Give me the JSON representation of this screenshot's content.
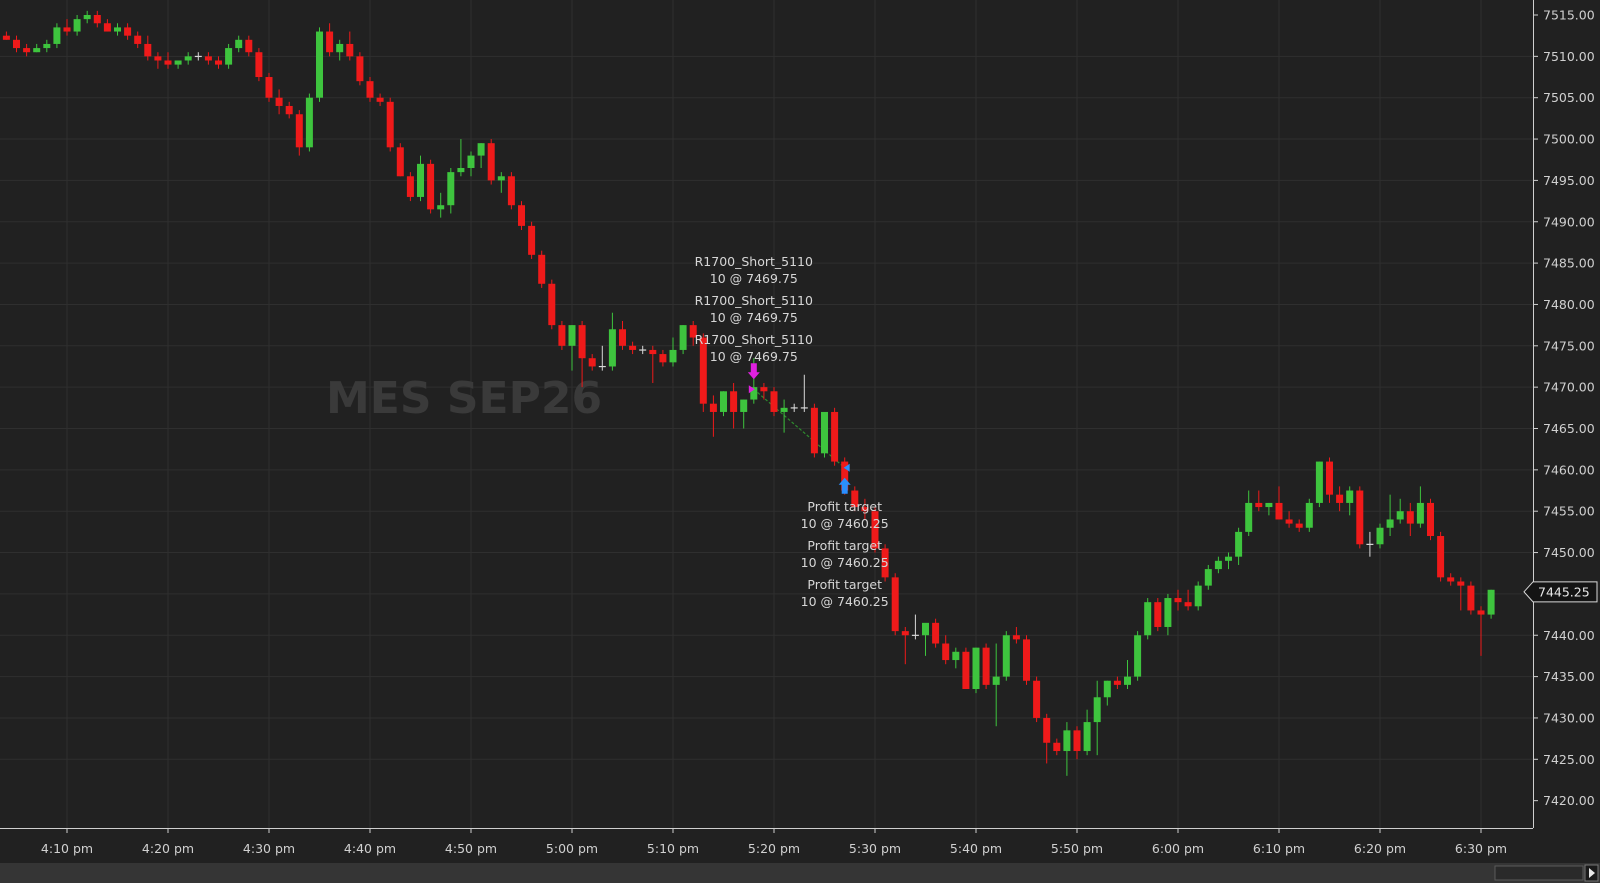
{
  "chart_data": {
    "type": "candlestick",
    "instrument": "MES SEP26",
    "last_price": "7445.25",
    "x_axis": {
      "tick_labels": [
        "4:10 pm",
        "4:20 pm",
        "4:30 pm",
        "4:40 pm",
        "4:50 pm",
        "5:00 pm",
        "5:10 pm",
        "5:20 pm",
        "5:30 pm",
        "5:40 pm",
        "5:50 pm",
        "6:00 pm",
        "6:10 pm",
        "6:20 pm",
        "6:30 pm"
      ],
      "first_tick_minutes": 250,
      "tick_step_minutes": 10
    },
    "y_axis": {
      "min": 7420,
      "max": 7515,
      "tick_step": 5,
      "tick_labels": [
        "7515.00",
        "7510.00",
        "7505.00",
        "7500.00",
        "7495.00",
        "7490.00",
        "7485.00",
        "7480.00",
        "7475.00",
        "7470.00",
        "7465.00",
        "7460.00",
        "7455.00",
        "7450.00",
        "7445.00",
        "7440.00",
        "7435.00",
        "7430.00",
        "7425.00",
        "7420.00"
      ]
    },
    "grid": true,
    "bar_interval_minutes": 1,
    "colors": {
      "up": "#3ec43e",
      "down": "#ef1a1a",
      "flat": "#d8d8d8",
      "entry_marker": "#e020e0",
      "exit_marker": "#2a8fff",
      "background": "#212121",
      "grid": "#2f2f2f"
    },
    "candles": [
      [
        243,
        7513,
        7513.5,
        7512.5,
        7512.5
      ],
      [
        244,
        7512.5,
        7513,
        7512,
        7512
      ],
      [
        245,
        7512,
        7512.5,
        7510.5,
        7511
      ],
      [
        246,
        7511,
        7511.5,
        7510,
        7510.5
      ],
      [
        247,
        7510.5,
        7511.5,
        7510.5,
        7511
      ],
      [
        248,
        7511,
        7512,
        7510.5,
        7511.5
      ],
      [
        249,
        7511.5,
        7514,
        7511,
        7513.5
      ],
      [
        250,
        7513.5,
        7514.5,
        7512.5,
        7513
      ],
      [
        251,
        7513,
        7515,
        7512.5,
        7514.5
      ],
      [
        252,
        7514.5,
        7515.5,
        7514,
        7515
      ],
      [
        253,
        7515,
        7515.5,
        7513.5,
        7514
      ],
      [
        254,
        7514,
        7514.5,
        7513,
        7513
      ],
      [
        255,
        7513,
        7514,
        7512.5,
        7513.5
      ],
      [
        256,
        7513.5,
        7514,
        7512,
        7512.5
      ],
      [
        257,
        7512.5,
        7513,
        7511,
        7511.5
      ],
      [
        258,
        7511.5,
        7512.5,
        7509.5,
        7510
      ],
      [
        259,
        7510,
        7510.5,
        7508.5,
        7509.5
      ],
      [
        260,
        7509.5,
        7510.5,
        7508.5,
        7509
      ],
      [
        261,
        7509,
        7509.5,
        7508.5,
        7509.5
      ],
      [
        262,
        7509.5,
        7510.5,
        7509,
        7510
      ],
      [
        263,
        7510,
        7510.5,
        7509.5,
        7510
      ],
      [
        264,
        7510,
        7510.5,
        7509,
        7509.5
      ],
      [
        265,
        7509.5,
        7510,
        7508.5,
        7509
      ],
      [
        266,
        7509,
        7511.5,
        7508.5,
        7511
      ],
      [
        267,
        7511,
        7512.5,
        7510.5,
        7512
      ],
      [
        268,
        7512,
        7512.5,
        7510,
        7510.5
      ],
      [
        269,
        7510.5,
        7511,
        7507,
        7507.5
      ],
      [
        270,
        7507.5,
        7508,
        7504.5,
        7505
      ],
      [
        271,
        7505,
        7506,
        7503,
        7504
      ],
      [
        272,
        7504,
        7504.5,
        7502.5,
        7503
      ],
      [
        273,
        7503,
        7503.5,
        7498,
        7499
      ],
      [
        274,
        7499,
        7505.5,
        7498.5,
        7505
      ],
      [
        275,
        7505,
        7513.5,
        7504.5,
        7513
      ],
      [
        276,
        7513,
        7514,
        7510,
        7510.5
      ],
      [
        277,
        7510.5,
        7512,
        7509.5,
        7511.5
      ],
      [
        278,
        7511.5,
        7513,
        7509.5,
        7510
      ],
      [
        279,
        7510,
        7510.5,
        7506.5,
        7507
      ],
      [
        280,
        7507,
        7507.5,
        7504.5,
        7505
      ],
      [
        281,
        7505,
        7505.5,
        7504,
        7504.5
      ],
      [
        282,
        7504.5,
        7505,
        7498.5,
        7499
      ],
      [
        283,
        7499,
        7499.5,
        7495.5,
        7495.5
      ],
      [
        284,
        7495.5,
        7496,
        7492.5,
        7493
      ],
      [
        285,
        7493,
        7498,
        7492.5,
        7497
      ],
      [
        286,
        7497,
        7497.5,
        7491,
        7491.5
      ],
      [
        287,
        7491.5,
        7493.5,
        7490.5,
        7492
      ],
      [
        288,
        7492,
        7496.5,
        7491,
        7496
      ],
      [
        289,
        7496,
        7500,
        7495.5,
        7496.5
      ],
      [
        290,
        7496.5,
        7498.5,
        7495.5,
        7498
      ],
      [
        291,
        7498,
        7499.5,
        7496.5,
        7499.5
      ],
      [
        292,
        7499.5,
        7500,
        7494.5,
        7495
      ],
      [
        293,
        7495,
        7496,
        7493.5,
        7495.5
      ],
      [
        294,
        7495.5,
        7496,
        7491.5,
        7492
      ],
      [
        295,
        7492,
        7492.5,
        7489,
        7489.5
      ],
      [
        296,
        7489.5,
        7490,
        7485.5,
        7486
      ],
      [
        297,
        7486,
        7486.5,
        7482,
        7482.5
      ],
      [
        298,
        7482.5,
        7483,
        7477,
        7477.5
      ],
      [
        299,
        7477.5,
        7478,
        7474.5,
        7475
      ],
      [
        300,
        7475,
        7477.5,
        7472,
        7477.5
      ],
      [
        301,
        7477.5,
        7478,
        7470,
        7473.5
      ],
      [
        302,
        7473.5,
        7474,
        7472,
        7472.5
      ],
      [
        303,
        7472.5,
        7475,
        7472,
        7472.5
      ],
      [
        304,
        7472.5,
        7479,
        7472,
        7477
      ],
      [
        305,
        7477,
        7478,
        7474.5,
        7475
      ],
      [
        306,
        7475,
        7475.5,
        7474,
        7474.5
      ],
      [
        307,
        7474.5,
        7475,
        7474,
        7474.5
      ],
      [
        308,
        7474.5,
        7475,
        7470.5,
        7474
      ],
      [
        309,
        7474,
        7474.5,
        7472.5,
        7473
      ],
      [
        310,
        7473,
        7476,
        7472.5,
        7474.5
      ],
      [
        311,
        7474.5,
        7477.5,
        7474,
        7477.5
      ],
      [
        312,
        7477.5,
        7478,
        7475,
        7476
      ],
      [
        313,
        7476,
        7476.5,
        7467,
        7468
      ],
      [
        314,
        7468,
        7469,
        7464,
        7467
      ],
      [
        315,
        7467,
        7469.5,
        7466.5,
        7469.5
      ],
      [
        316,
        7469.5,
        7470.5,
        7465,
        7467
      ],
      [
        317,
        7467,
        7468.5,
        7465,
        7468.5
      ],
      [
        318,
        7468.5,
        7473.5,
        7468,
        7470
      ],
      [
        319,
        7470,
        7470.5,
        7468.5,
        7469.5
      ],
      [
        320,
        7469.5,
        7470,
        7466.5,
        7467
      ],
      [
        321,
        7467,
        7468.5,
        7464.5,
        7467.5
      ],
      [
        322,
        7467.5,
        7468,
        7467,
        7467.5
      ],
      [
        323,
        7467.5,
        7471.5,
        7467,
        7467.5
      ],
      [
        324,
        7467.5,
        7468,
        7461.5,
        7462
      ],
      [
        325,
        7462,
        7467,
        7461.5,
        7467
      ],
      [
        326,
        7467,
        7467.5,
        7460.5,
        7461
      ],
      [
        327,
        7461,
        7461.5,
        7457,
        7457.5
      ],
      [
        328,
        7457.5,
        7458,
        7455,
        7455.5
      ],
      [
        329,
        7455.5,
        7456.5,
        7454,
        7455
      ],
      [
        330,
        7455,
        7455.5,
        7450,
        7450.5
      ],
      [
        331,
        7450.5,
        7451,
        7446.5,
        7447
      ],
      [
        332,
        7447,
        7447.5,
        7440,
        7440.5
      ],
      [
        333,
        7440.5,
        7441,
        7436.5,
        7440
      ],
      [
        334,
        7440,
        7442.5,
        7439.5,
        7440
      ],
      [
        335,
        7440,
        7440.5,
        7437.5,
        7441.5
      ],
      [
        336,
        7441.5,
        7442,
        7438.5,
        7439
      ],
      [
        337,
        7439,
        7440,
        7436.5,
        7437
      ],
      [
        338,
        7437,
        7438.5,
        7436,
        7438
      ],
      [
        339,
        7438,
        7438.5,
        7433.5,
        7433.5
      ],
      [
        340,
        7433.5,
        7438.5,
        7433,
        7438.5
      ],
      [
        341,
        7438.5,
        7439,
        7433.5,
        7434
      ],
      [
        342,
        7434,
        7439,
        7429,
        7435
      ],
      [
        343,
        7435,
        7440.5,
        7434.5,
        7440
      ],
      [
        344,
        7440,
        7441,
        7439,
        7439.5
      ],
      [
        345,
        7439.5,
        7440,
        7434,
        7434.5
      ],
      [
        346,
        7434.5,
        7435,
        7429.5,
        7430
      ],
      [
        347,
        7430,
        7430.5,
        7424.5,
        7427
      ],
      [
        348,
        7427,
        7427.5,
        7425.5,
        7426
      ],
      [
        349,
        7426,
        7429.5,
        7423,
        7428.5
      ],
      [
        350,
        7428.5,
        7429,
        7425,
        7426
      ],
      [
        351,
        7426,
        7431,
        7425.5,
        7429.5
      ],
      [
        352,
        7429.5,
        7434.5,
        7425.5,
        7432.5
      ],
      [
        353,
        7432.5,
        7434.5,
        7431.5,
        7434.5
      ],
      [
        354,
        7434.5,
        7435,
        7433.5,
        7434
      ],
      [
        355,
        7434,
        7437,
        7433.5,
        7435
      ],
      [
        356,
        7435,
        7440.5,
        7434.5,
        7440
      ],
      [
        357,
        7440,
        7444.5,
        7439.5,
        7444
      ],
      [
        358,
        7444,
        7444.5,
        7440.5,
        7441
      ],
      [
        359,
        7441,
        7445,
        7440,
        7444.5
      ],
      [
        360,
        7444.5,
        7445.5,
        7443,
        7444
      ],
      [
        361,
        7444,
        7445.5,
        7443,
        7443.5
      ],
      [
        362,
        7443.5,
        7446.5,
        7443,
        7446
      ],
      [
        363,
        7446,
        7448.5,
        7445.5,
        7448
      ],
      [
        364,
        7448,
        7449.5,
        7447.5,
        7449
      ],
      [
        365,
        7449,
        7450,
        7448,
        7449.5
      ],
      [
        366,
        7449.5,
        7453,
        7448.5,
        7452.5
      ],
      [
        367,
        7452.5,
        7457.5,
        7452,
        7456
      ],
      [
        368,
        7456,
        7457.5,
        7455,
        7455.5
      ],
      [
        369,
        7455.5,
        7456,
        7454.5,
        7456
      ],
      [
        370,
        7456,
        7458,
        7454,
        7454
      ],
      [
        371,
        7454,
        7455,
        7453,
        7453.5
      ],
      [
        372,
        7453.5,
        7454,
        7452.5,
        7453
      ],
      [
        373,
        7453,
        7456.5,
        7452.5,
        7456
      ],
      [
        374,
        7456,
        7461,
        7455.5,
        7461
      ],
      [
        375,
        7461,
        7461.5,
        7456,
        7457
      ],
      [
        376,
        7457,
        7458,
        7455,
        7456
      ],
      [
        377,
        7456,
        7458,
        7454.5,
        7457.5
      ],
      [
        378,
        7457.5,
        7458,
        7450.5,
        7451
      ],
      [
        379,
        7451,
        7452.5,
        7449.5,
        7451
      ],
      [
        380,
        7451,
        7453.5,
        7450.5,
        7453
      ],
      [
        381,
        7453,
        7457,
        7452,
        7454
      ],
      [
        382,
        7454,
        7456.5,
        7453.5,
        7455
      ],
      [
        383,
        7455,
        7456,
        7452,
        7453.5
      ],
      [
        384,
        7453.5,
        7458,
        7453,
        7456
      ],
      [
        385,
        7456,
        7456.5,
        7451.5,
        7452
      ],
      [
        386,
        7452,
        7452.5,
        7446.5,
        7447
      ],
      [
        387,
        7447,
        7447.5,
        7446,
        7446.5
      ],
      [
        388,
        7446.5,
        7447,
        7443,
        7446
      ],
      [
        389,
        7446,
        7446.5,
        7442.5,
        7443
      ],
      [
        390,
        7443,
        7443.5,
        7437.5,
        7442.5
      ],
      [
        391,
        7442.5,
        7445.5,
        7442,
        7445.5
      ]
    ],
    "trades": [
      {
        "side": "entry",
        "label": "R1700_Short_5110",
        "detail": "10 @ 7469.75",
        "count": 3,
        "minute": 318,
        "price": 7469.75
      },
      {
        "side": "exit",
        "label": "Profit target",
        "detail": "10 @ 7460.25",
        "count": 3,
        "minute": 327,
        "price": 7460.25
      }
    ]
  }
}
